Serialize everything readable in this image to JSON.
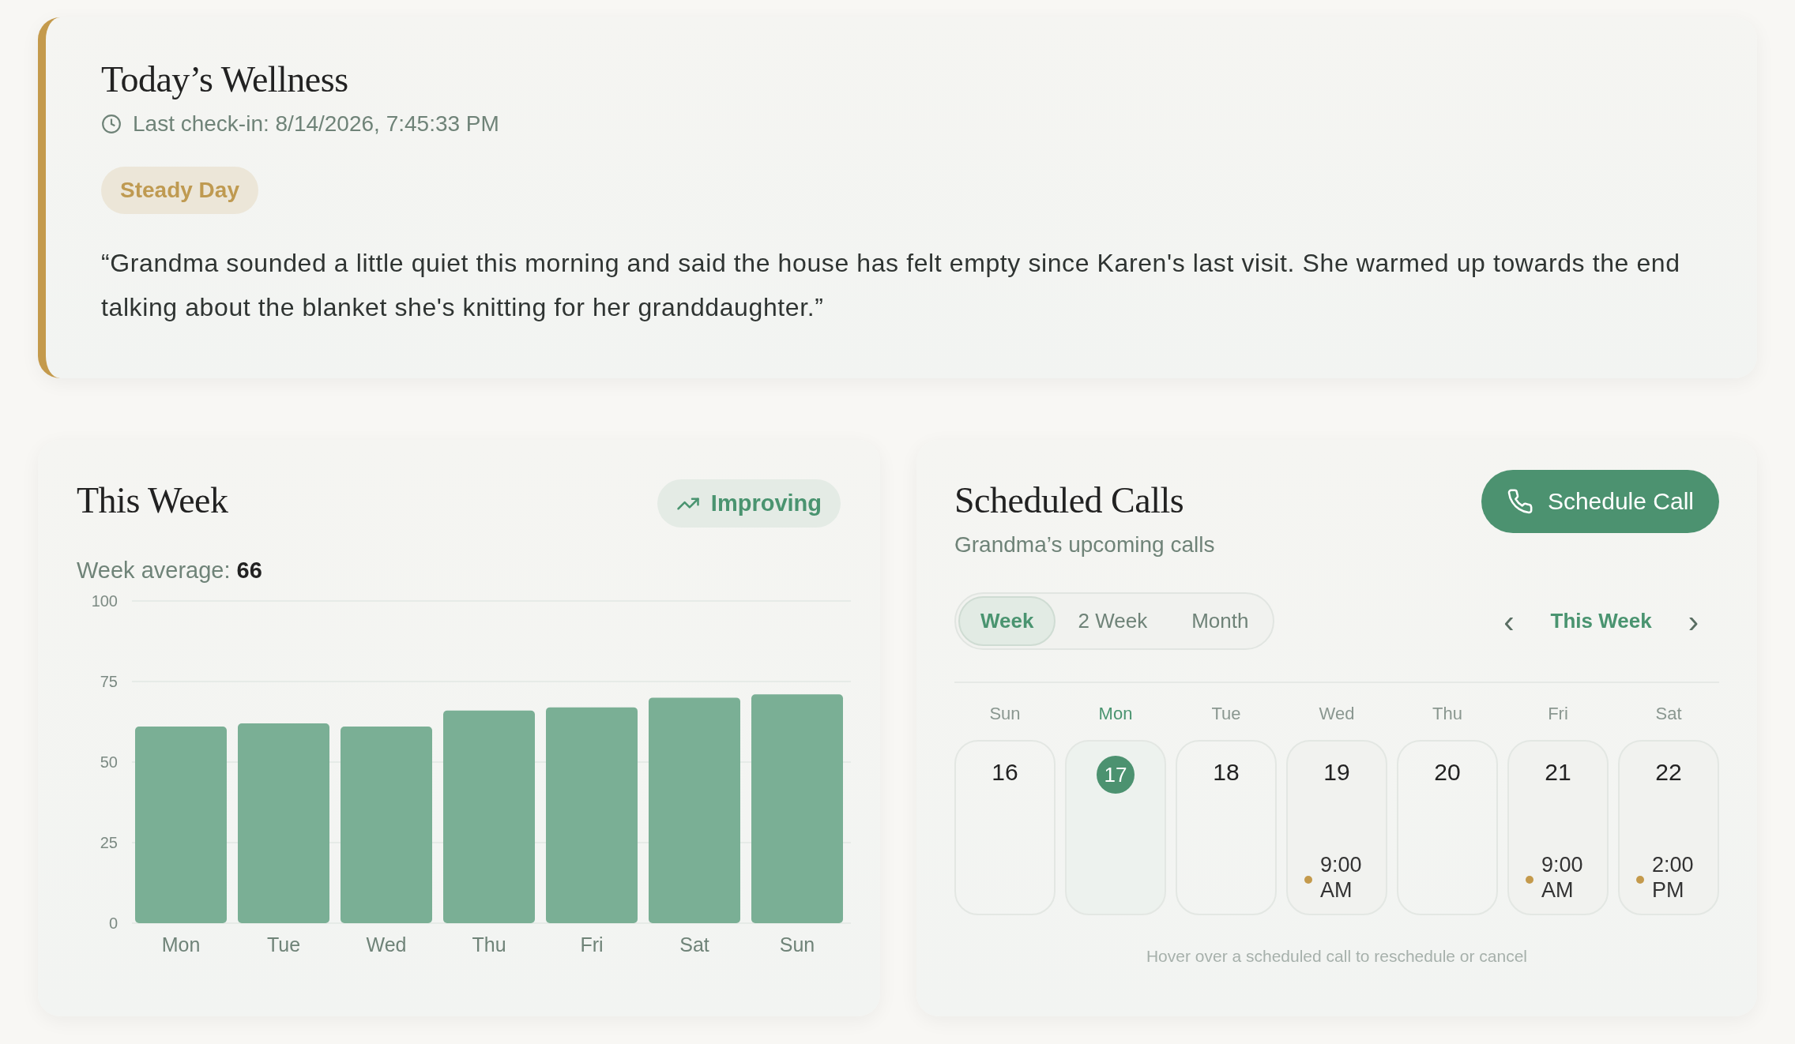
{
  "wellness": {
    "title": "Today’s Wellness",
    "last_checkin": "Last check-in: 8/14/2026, 7:45:33 PM",
    "mood": "Steady Day",
    "quote": "“Grandma sounded a little quiet this morning and said the house has felt empty since Karen's last visit. She warmed up towards the end talking about the blanket she's knitting for her granddaughter.”"
  },
  "this_week": {
    "title": "This Week",
    "trend": "Improving",
    "average_label": "Week average:",
    "average_value": "66",
    "chart_data": {
      "type": "bar",
      "grid": true,
      "categories": [
        "Mon",
        "Tue",
        "Wed",
        "Thu",
        "Fri",
        "Sat",
        "Sun"
      ],
      "values": [
        61,
        62,
        61,
        66,
        67,
        70,
        71
      ],
      "ylim": [
        0,
        100
      ],
      "yticks": [
        0,
        25,
        50,
        75,
        100
      ]
    }
  },
  "scheduled_calls": {
    "title": "Scheduled Calls",
    "subtitle": "Grandma’s upcoming calls",
    "button": "Schedule Call",
    "views": [
      {
        "label": "Week",
        "selected": true
      },
      {
        "label": "2 Week",
        "selected": false
      },
      {
        "label": "Month",
        "selected": false
      }
    ],
    "range_label": "This Week",
    "prev": "‹",
    "next": "›",
    "days": [
      {
        "name": "Sun",
        "date": "16",
        "today": false
      },
      {
        "name": "Mon",
        "date": "17",
        "today": true
      },
      {
        "name": "Tue",
        "date": "18",
        "today": false
      },
      {
        "name": "Wed",
        "date": "19",
        "today": false,
        "calls": [
          {
            "time": "9:00 AM",
            "color": "#c49a4c"
          }
        ]
      },
      {
        "name": "Thu",
        "date": "20",
        "today": false
      },
      {
        "name": "Fri",
        "date": "21",
        "today": false,
        "calls": [
          {
            "time": "9:00 AM",
            "color": "#c49a4c"
          }
        ]
      },
      {
        "name": "Sat",
        "date": "22",
        "today": false,
        "calls": [
          {
            "time": "2:00 PM",
            "color": "#c49a4c"
          }
        ]
      }
    ],
    "hint": "Hover over a scheduled call to reschedule or cancel"
  }
}
